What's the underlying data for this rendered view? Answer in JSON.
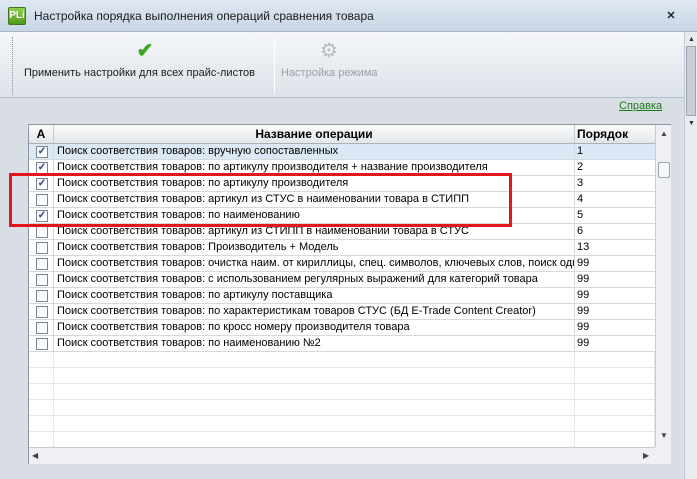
{
  "window": {
    "title": "Настройка порядка выполнения операций сравнения товара",
    "app_icon_text": "PLi",
    "close_glyph": "✕"
  },
  "toolbar": {
    "apply_label": "Применить настройки для всех прайс-листов",
    "apply_icon": "checkmark-icon",
    "mode_label": "Настройка режима",
    "mode_icon": "gear-icon"
  },
  "help_link": "Справка",
  "grid": {
    "columns": [
      "A",
      "Название операции",
      "Порядок"
    ],
    "rows": [
      {
        "checked": true,
        "name": "Поиск соответствия товаров: вручную сопоставленных",
        "order": "1"
      },
      {
        "checked": true,
        "name": "Поиск соответствия товаров: по артикулу производителя + название производителя",
        "order": "2"
      },
      {
        "checked": true,
        "name": "Поиск соответствия товаров: по артикулу производителя",
        "order": "3"
      },
      {
        "checked": false,
        "name": "Поиск соответствия товаров: артикул из СТУС в наименовании товара в СТИПП",
        "order": "4"
      },
      {
        "checked": true,
        "name": "Поиск соответствия товаров: по наименованию",
        "order": "5"
      },
      {
        "checked": false,
        "name": "Поиск соответствия товаров: артикул из СТИПП в наименовании товара в СТУС",
        "order": "6"
      },
      {
        "checked": false,
        "name": "Поиск соответствия товаров: Производитель + Модель",
        "order": "13"
      },
      {
        "checked": false,
        "name": "Поиск соответствия товаров: очистка наим. от кириллицы, спец. символов, ключевых слов, поиск одного",
        "order": "99"
      },
      {
        "checked": false,
        "name": "Поиск соответствия товаров: с использованием регулярных выражений для категорий товара",
        "order": "99"
      },
      {
        "checked": false,
        "name": "Поиск соответствия товаров: по артикулу поставщика",
        "order": "99"
      },
      {
        "checked": false,
        "name": "Поиск соответствия товаров: по характеристикам товаров СТУС (БД E-Trade Content Creator)",
        "order": "99"
      },
      {
        "checked": false,
        "name": "Поиск соответствия товаров: по кросс номеру производителя товара",
        "order": "99"
      },
      {
        "checked": false,
        "name": "Поиск соответствия товаров: по наименованию №2",
        "order": "99"
      }
    ],
    "selected_row": 0
  },
  "colors": {
    "annotation_box": "#e3161c",
    "help_link": "#1a7a1a",
    "selection": "#dde8f6"
  }
}
